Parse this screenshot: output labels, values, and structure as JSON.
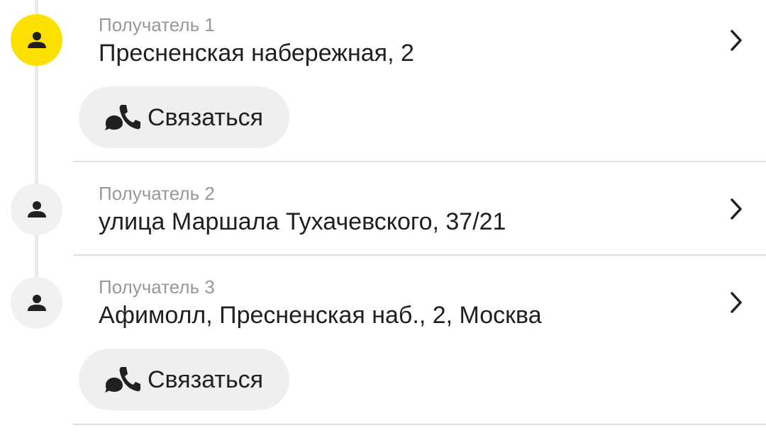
{
  "colors": {
    "accent": "#fce000",
    "avatar_inactive": "#f2f1ef",
    "button_bg": "#f0efed",
    "text_primary": "#21201f",
    "text_secondary": "#9a9895"
  },
  "recipients": [
    {
      "label": "Получатель 1",
      "address": "Пресненская набережная, 2",
      "active": true,
      "icon": "person-icon",
      "contact_button": {
        "label": "Связаться",
        "icon": "chat-phone-icon"
      }
    },
    {
      "label": "Получатель 2",
      "address": "улица Маршала Тухачевского, 37/21",
      "active": false,
      "icon": "person-icon"
    },
    {
      "label": "Получатель 3",
      "address": "Афимолл, Пресненская наб., 2, Москва",
      "active": false,
      "icon": "person-icon",
      "contact_button": {
        "label": "Связаться",
        "icon": "chat-phone-icon"
      }
    }
  ]
}
